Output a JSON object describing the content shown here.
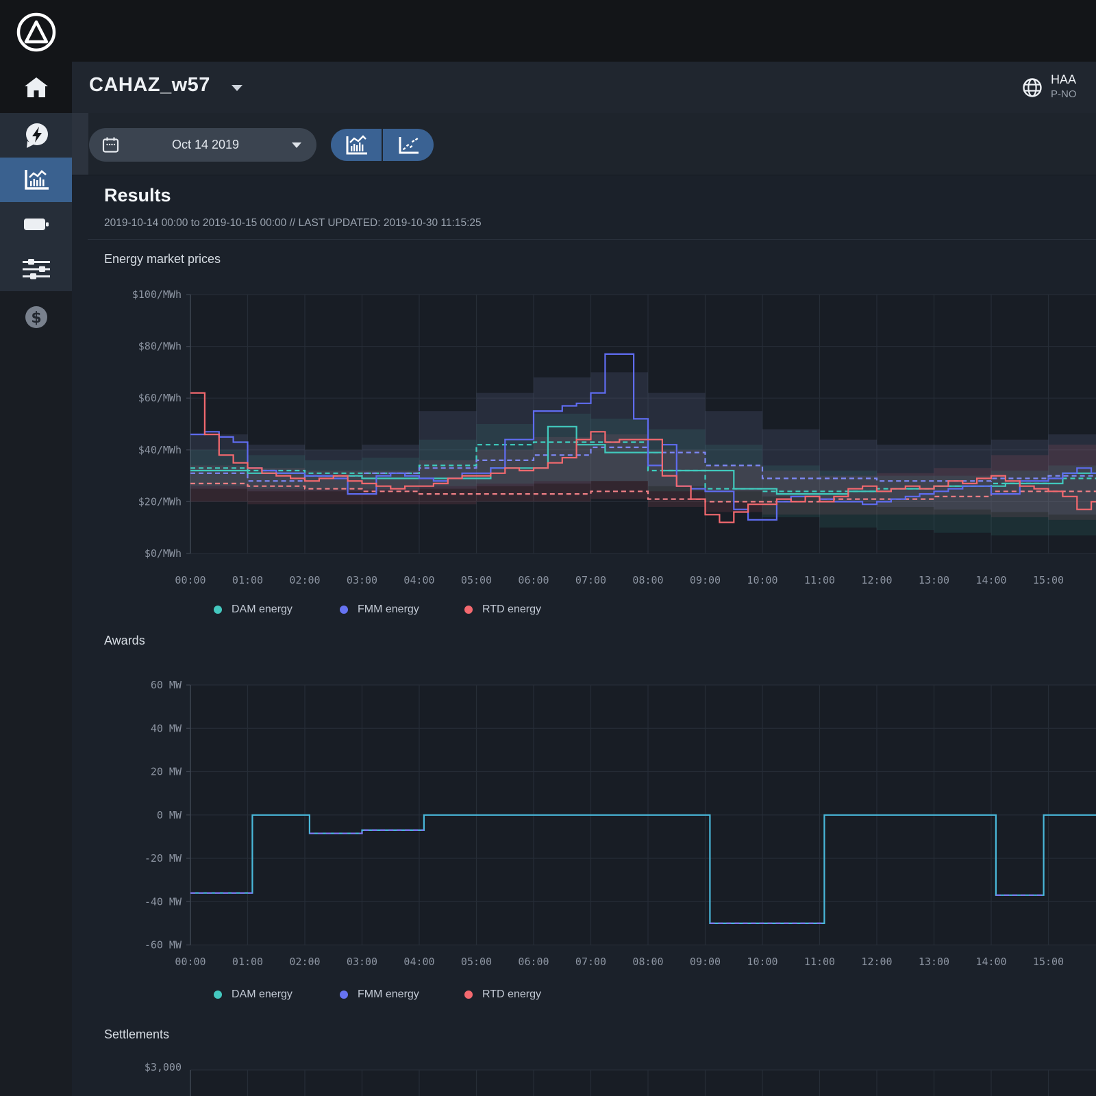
{
  "app": {
    "topbar": {
      "logo_icon": "delta-circle-logo"
    },
    "header": {
      "title": "CAHAZ_w57",
      "account_line1": "HAA",
      "account_line2": "P-NO"
    },
    "sidebar": {
      "items": [
        {
          "id": "home",
          "icon": "home-icon",
          "selected": false
        },
        {
          "id": "energy",
          "icon": "bolt-bubble-icon",
          "selected": false
        },
        {
          "id": "results",
          "icon": "chart-icon",
          "selected": true
        },
        {
          "id": "battery",
          "icon": "battery-icon",
          "selected": false
        },
        {
          "id": "settings",
          "icon": "sliders-icon",
          "selected": false
        },
        {
          "id": "billing",
          "icon": "dollar-icon",
          "selected": false
        }
      ]
    },
    "toolbar": {
      "date_value": "Oct 14 2019",
      "view_buttons": [
        "bar-line-chart",
        "scatter-chart"
      ]
    },
    "results": {
      "title": "Results",
      "subtitle": "2019-10-14 00:00 to 2019-10-15 00:00 // LAST UPDATED: 2019-10-30 11:15:25"
    },
    "sections": {
      "prices_title": "Energy market prices",
      "awards_title": "Awards",
      "settlements_title": "Settlements"
    },
    "legend": {
      "items": [
        {
          "label": "DAM energy",
          "color": "#44c8bf"
        },
        {
          "label": "FMM energy",
          "color": "#6673f2"
        },
        {
          "label": "RTD energy",
          "color": "#f4696f"
        }
      ]
    }
  },
  "chart_data": [
    {
      "type": "line",
      "title": "Energy market prices",
      "x_unit": "hour of 2019-10-14",
      "x_range": [
        0,
        16
      ],
      "ylim": [
        0,
        100
      ],
      "grid": true,
      "legend_position": "bottom",
      "x_tick_labels": [
        "00:00",
        "01:00",
        "02:00",
        "03:00",
        "04:00",
        "05:00",
        "06:00",
        "07:00",
        "08:00",
        "09:00",
        "10:00",
        "11:00",
        "12:00",
        "13:00",
        "14:00",
        "15:00"
      ],
      "y_ticks": [
        {
          "v": 0,
          "label": "$0/MWh"
        },
        {
          "v": 20,
          "label": "$20/MWh"
        },
        {
          "v": 40,
          "label": "$40/MWh"
        },
        {
          "v": 60,
          "label": "$60/MWh"
        },
        {
          "v": 80,
          "label": "$80/MWh"
        },
        {
          "v": 100,
          "label": "$100/MWh"
        }
      ],
      "bands": [
        {
          "name": "FMM energy range",
          "color": "rgba(120,132,180,0.16)",
          "step_hours": 1,
          "low": [
            25,
            24,
            24,
            24,
            25,
            26,
            27,
            28,
            26,
            24,
            22,
            20,
            18,
            17,
            16,
            15
          ],
          "high": [
            46,
            42,
            40,
            42,
            55,
            62,
            68,
            70,
            62,
            55,
            48,
            44,
            42,
            42,
            44,
            46
          ]
        },
        {
          "name": "RTD energy range",
          "color": "rgba(235,100,115,0.13)",
          "step_hours": 1,
          "low": [
            20,
            19,
            19,
            19,
            19,
            20,
            20,
            21,
            18,
            16,
            15,
            15,
            15,
            15,
            14,
            13
          ],
          "high": [
            34,
            33,
            32,
            32,
            36,
            40,
            45,
            46,
            40,
            34,
            32,
            30,
            31,
            33,
            38,
            42
          ]
        },
        {
          "name": "DAM energy range",
          "color": "rgba(70,205,190,0.10)",
          "step_hours": 1,
          "low": [
            26,
            25,
            25,
            25,
            26,
            27,
            28,
            28,
            24,
            20,
            14,
            10,
            9,
            8,
            7,
            7
          ],
          "high": [
            40,
            38,
            36,
            37,
            44,
            50,
            54,
            52,
            48,
            42,
            34,
            32,
            30,
            30,
            32,
            34
          ]
        }
      ],
      "series": [
        {
          "name": "DAM energy forecast",
          "style": "dashed",
          "color": "#3ecfc0",
          "step_hours": 1,
          "values": [
            33,
            32,
            31,
            31,
            34,
            42,
            43,
            43,
            32,
            25,
            24,
            24,
            25,
            26,
            27,
            29
          ]
        },
        {
          "name": "FMM energy forecast",
          "style": "dashed",
          "color": "#7d88f5",
          "step_hours": 1,
          "values": [
            31,
            28,
            30,
            31,
            33,
            36,
            38,
            41,
            39,
            34,
            29,
            29,
            28,
            28,
            29,
            30
          ]
        },
        {
          "name": "RTD energy forecast",
          "style": "dashed",
          "color": "#f07f85",
          "step_hours": 1,
          "values": [
            27,
            26,
            25,
            24,
            23,
            23,
            23,
            24,
            21,
            20,
            20,
            21,
            21,
            22,
            24,
            24
          ]
        },
        {
          "name": "DAM energy",
          "style": "solid",
          "color": "#41c9bd",
          "step_hours": 0.25,
          "values": [
            32,
            32,
            32,
            32,
            31,
            31,
            31,
            31,
            30,
            30,
            30,
            30,
            29,
            29,
            29,
            29,
            29,
            29,
            29,
            29,
            29,
            33,
            33,
            33,
            33,
            49,
            49,
            42,
            42,
            39,
            39,
            39,
            39,
            32,
            32,
            32,
            32,
            32,
            25,
            25,
            25,
            23,
            23,
            23,
            23,
            23,
            24,
            24,
            24,
            25,
            25,
            25,
            26,
            26,
            26,
            26,
            26,
            27,
            27,
            27,
            27,
            31,
            31,
            31
          ]
        },
        {
          "name": "FMM energy",
          "style": "solid",
          "color": "#5f6cf0",
          "step_hours": 0.25,
          "values": [
            46,
            47,
            45,
            43,
            33,
            32,
            31,
            31,
            30,
            30,
            29,
            23,
            23,
            30,
            31,
            30,
            29,
            28,
            29,
            31,
            31,
            33,
            44,
            44,
            55,
            55,
            57,
            58,
            62,
            77,
            77,
            52,
            34,
            42,
            26,
            25,
            24,
            24,
            17,
            13,
            13,
            20,
            22,
            22,
            21,
            20,
            20,
            19,
            20,
            21,
            22,
            23,
            24,
            25,
            26,
            26,
            23,
            23,
            28,
            28,
            29,
            31,
            33,
            31
          ]
        },
        {
          "name": "RTD energy",
          "style": "solid",
          "color": "#f4696f",
          "step_hours": 0.25,
          "values": [
            62,
            46,
            38,
            35,
            33,
            31,
            30,
            29,
            28,
            29,
            30,
            28,
            27,
            26,
            25,
            26,
            26,
            27,
            29,
            30,
            30,
            31,
            33,
            32,
            33,
            35,
            37,
            44,
            47,
            43,
            44,
            44,
            44,
            30,
            26,
            21,
            15,
            12,
            16,
            19,
            19,
            21,
            20,
            22,
            20,
            22,
            25,
            26,
            24,
            25,
            26,
            25,
            26,
            28,
            27,
            29,
            30,
            28,
            26,
            25,
            24,
            22,
            17,
            20
          ]
        }
      ]
    },
    {
      "type": "line",
      "title": "Awards",
      "x_unit": "hour of 2019-10-14",
      "x_range": [
        0,
        16
      ],
      "ylim": [
        -60,
        60
      ],
      "grid": true,
      "legend_position": "bottom",
      "x_tick_labels": [
        "00:00",
        "01:00",
        "02:00",
        "03:00",
        "04:00",
        "05:00",
        "06:00",
        "07:00",
        "08:00",
        "09:00",
        "10:00",
        "11:00",
        "12:00",
        "13:00",
        "14:00",
        "15:00"
      ],
      "y_ticks": [
        {
          "v": -60,
          "label": "-60 MW"
        },
        {
          "v": -40,
          "label": "-40 MW"
        },
        {
          "v": -20,
          "label": "-20 MW"
        },
        {
          "v": 0,
          "label": "0 MW"
        },
        {
          "v": 20,
          "label": "20 MW"
        },
        {
          "v": 40,
          "label": "40 MW"
        },
        {
          "v": 60,
          "label": "60 MW"
        }
      ],
      "series": [
        {
          "name": "DAM energy",
          "style": "solid",
          "color": "#49b8da",
          "segments": [
            [
              0,
              1.083,
              -36
            ],
            [
              1.083,
              2.083,
              0
            ],
            [
              2.083,
              3,
              -8.5
            ],
            [
              3,
              4.083,
              -7
            ],
            [
              4.083,
              9.083,
              0
            ],
            [
              9.083,
              11.083,
              -50
            ],
            [
              11.083,
              14.083,
              0
            ],
            [
              14.083,
              14.917,
              -37
            ],
            [
              14.917,
              16,
              0
            ]
          ]
        },
        {
          "name": "FMM energy",
          "style": "dashed",
          "color": "#7f74f2",
          "segments": [
            [
              0,
              1.083,
              -36
            ],
            [
              2.083,
              3,
              -8.5
            ],
            [
              3,
              4.083,
              -7
            ],
            [
              9.083,
              11.083,
              -50
            ],
            [
              14.083,
              14.917,
              -37
            ]
          ]
        }
      ]
    },
    {
      "type": "line",
      "title": "Settlements",
      "x_range": [
        0,
        16
      ],
      "clipped_bottom": true,
      "y_ticks": [
        {
          "v": 3000,
          "label": "$3,000"
        }
      ],
      "series": []
    }
  ]
}
